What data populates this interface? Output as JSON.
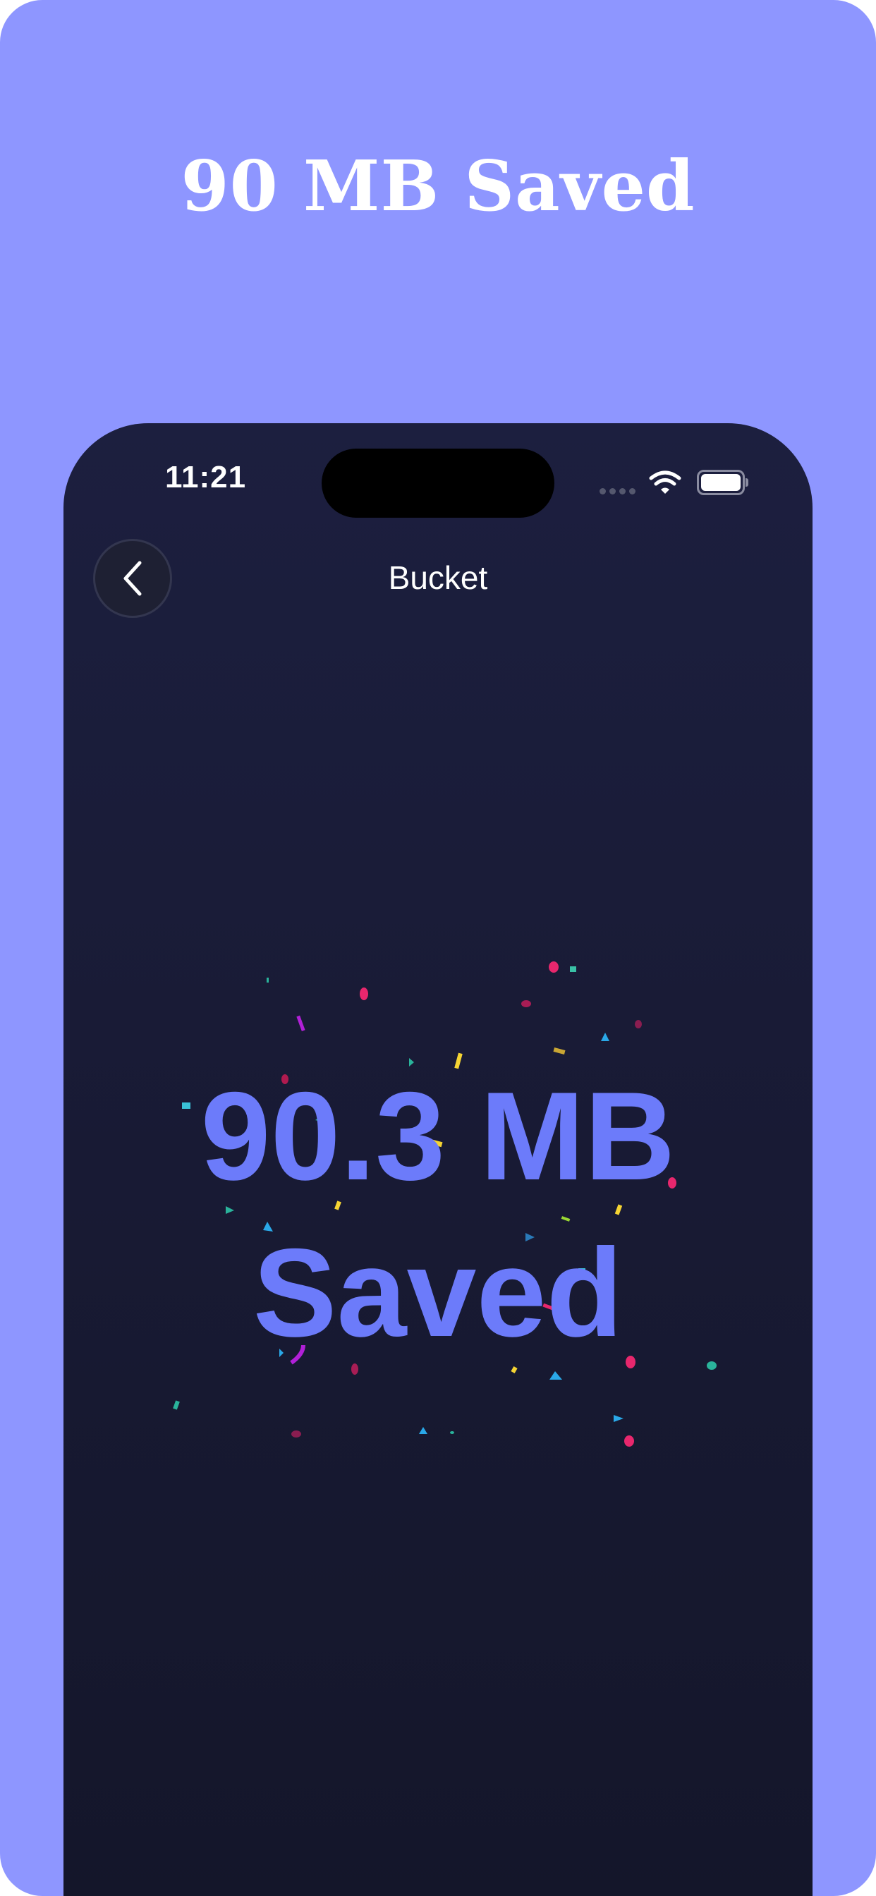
{
  "promo": {
    "headline": "90 MB Saved"
  },
  "status_bar": {
    "time": "11:21",
    "icons": [
      "cellular-signal-icon",
      "wifi-icon",
      "battery-icon"
    ]
  },
  "nav": {
    "back_icon": "chevron-left-icon",
    "title": "Bucket"
  },
  "result": {
    "amount": "90.3 MB",
    "label": "Saved"
  },
  "colors": {
    "page_background": "#8E96FF",
    "phone_background": "#1C1F3F",
    "accent": "#6C7BFA",
    "text_primary": "#FFFFFF"
  }
}
